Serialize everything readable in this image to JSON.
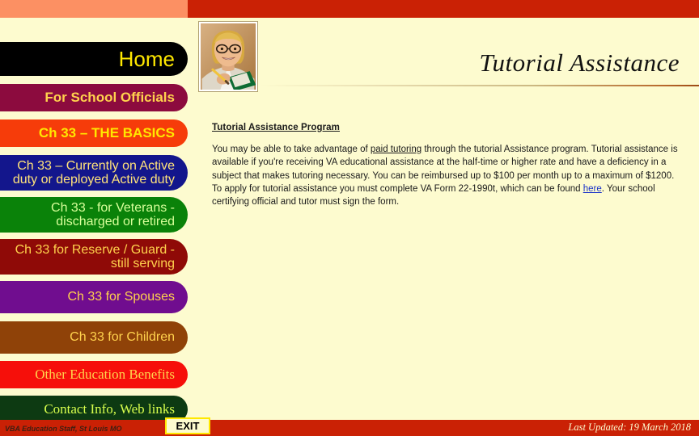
{
  "header": {
    "title": "Tutorial Assistance",
    "bar_left_color": "#fc9063",
    "bar_right_color": "#ca2105",
    "photo_alt": "woman-with-clipboard-photo"
  },
  "sidebar": {
    "items": [
      {
        "label": "Home",
        "bg": "#000000",
        "fg": "#ffe800"
      },
      {
        "label": "For School Officials",
        "bg": "#8c0b3e",
        "fg": "#ffd24d"
      },
      {
        "label": "Ch 33 – THE BASICS",
        "bg": "#f63c0a",
        "fg": "#ffe800"
      },
      {
        "label": "Ch 33 – Currently on Active\nduty or deployed Active duty",
        "bg": "#13168c",
        "fg": "#ffe37a"
      },
      {
        "label": "Ch 33 - for Veterans -\ndischarged or retired",
        "bg": "#0a8209",
        "fg": "#d8ff9a"
      },
      {
        "label": "Ch 33 for Reserve / Guard -\nstill serving",
        "bg": "#8f0a07",
        "fg": "#ffd24d"
      },
      {
        "label": "Ch 33 for Spouses",
        "bg": "#700d8f",
        "fg": "#ffd24d"
      },
      {
        "label": "Ch 33 for Children",
        "bg": "#8f4208",
        "fg": "#ffd24d"
      },
      {
        "label": "Other Education Benefits",
        "bg": "#f60f0a",
        "fg": "#ffd24d"
      },
      {
        "label": "Contact Info, Web links",
        "bg": "#0d3a12",
        "fg": "#d8ff4d"
      }
    ]
  },
  "main": {
    "heading": "Tutorial Assistance Program",
    "paragraph": {
      "seg1": "You may be able to take advantage of ",
      "link1": "paid tutoring",
      "seg2": " through the tutorial Assistance program. Tutorial assistance is available if you're receiving VA educational assistance at the half-time or higher rate and have a deficiency in a subject that makes tutoring necessary. You can be reimbursed up to $100 per month up to a maximum of $1200. To apply for tutorial assistance you must complete VA Form 22-1990t, which can be found ",
      "link2": "here",
      "seg3": ". Your school certifying official and tutor must sign the form."
    }
  },
  "footer": {
    "left_text": "VBA Education Staff, St Louis MO",
    "exit_label": "EXIT",
    "right_text": "Last Updated: 19 March 2018",
    "bar_color": "#ca2105"
  }
}
